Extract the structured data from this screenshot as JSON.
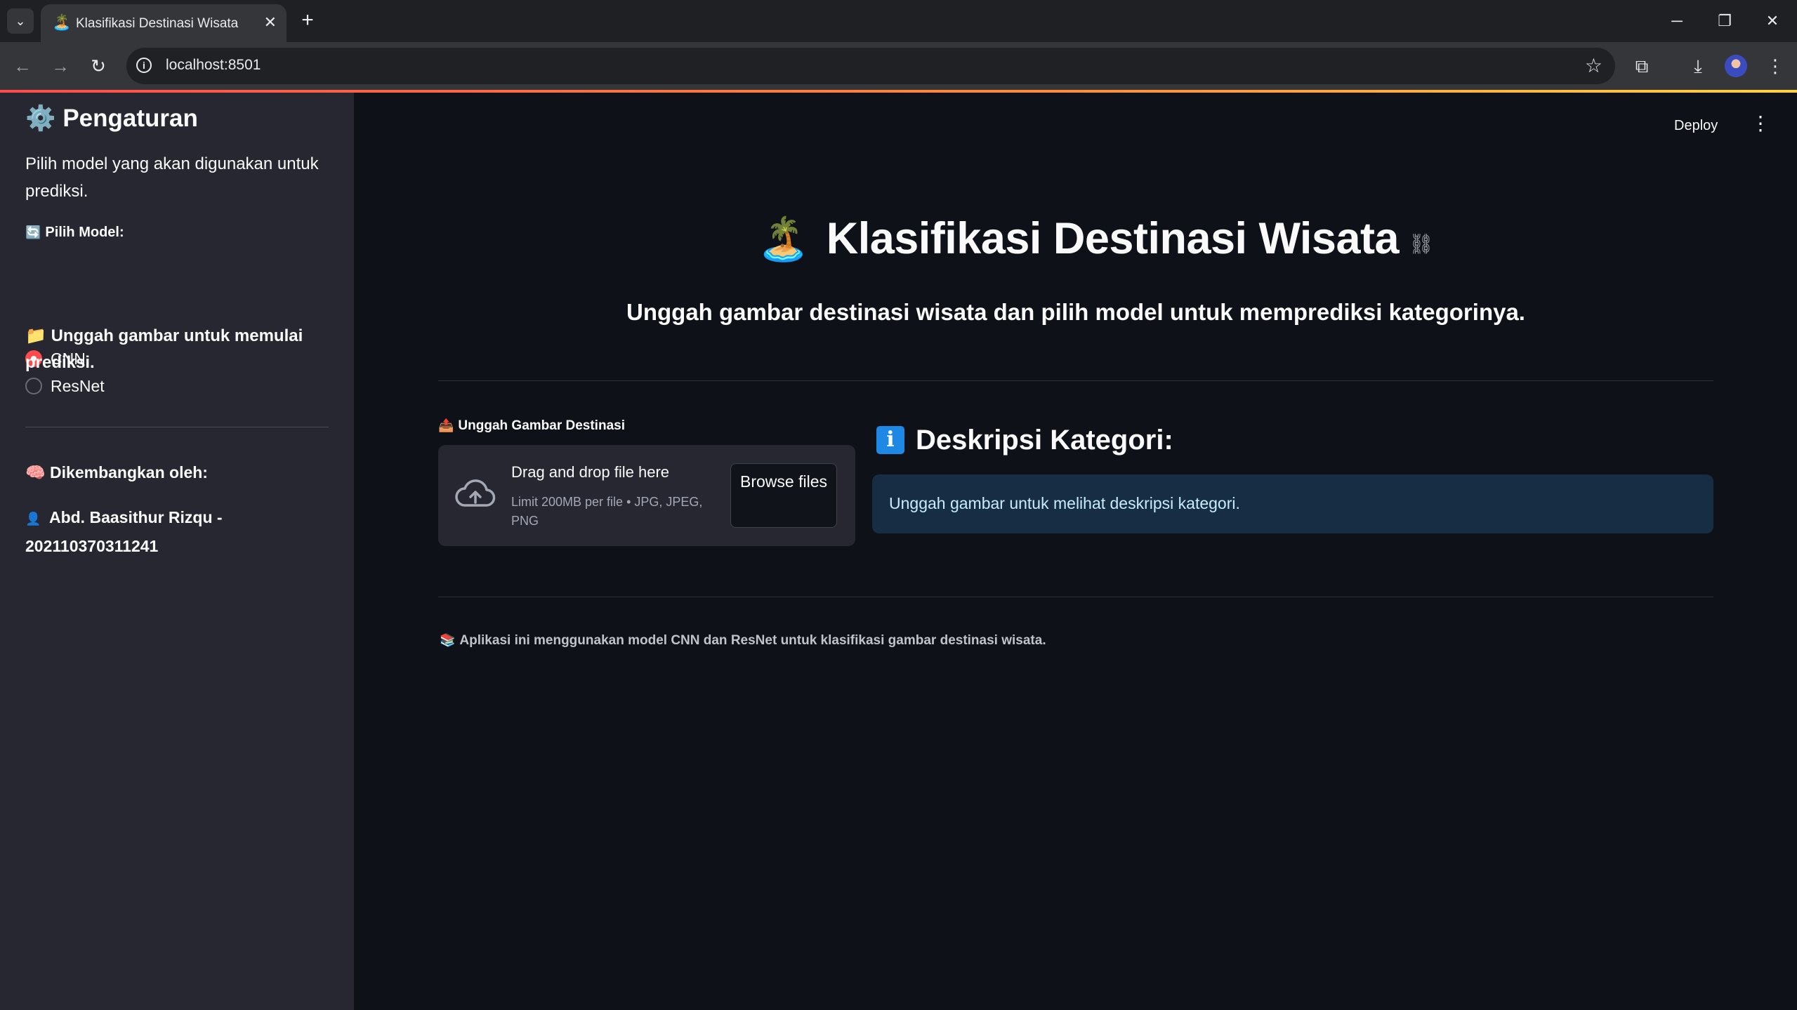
{
  "browser": {
    "tab_title": "Klasifikasi Destinasi Wisata",
    "tab_favicon": "🏝️",
    "url": "localhost:8501"
  },
  "sidebar": {
    "title_icon": "⚙️",
    "title": "Pengaturan",
    "description": "Pilih model yang akan digunakan untuk prediksi.",
    "model_label_icon": "🔄",
    "model_label": "Pilih Model:",
    "options": [
      {
        "label": "CNN",
        "selected": true
      },
      {
        "label": "ResNet",
        "selected": false
      }
    ],
    "hint_icon": "📁",
    "hint": "Unggah gambar untuk memulai prediksi.",
    "developed_icon": "🧠",
    "developed_by": "Dikembangkan oleh:",
    "author_icon": "👤",
    "author": "Abd. Baasithur Rizqu - 202110370311241"
  },
  "header": {
    "deploy_label": "Deploy"
  },
  "main": {
    "title_icon": "🏝️",
    "title": "Klasifikasi Destinasi Wisata",
    "subtitle": "Unggah gambar destinasi wisata dan pilih model untuk memprediksi kategorinya.",
    "upload": {
      "label_icon": "📤",
      "label": "Unggah Gambar Destinasi",
      "drag_text": "Drag and drop file here",
      "limit_text": "Limit 200MB per file • JPG, JPEG, PNG",
      "browse_label": "Browse files"
    },
    "description": {
      "icon": "i",
      "heading": "Deskripsi Kategori:",
      "info_text": "Unggah gambar untuk melihat deskripsi kategori."
    },
    "footer_icon": "📚",
    "footer": "Aplikasi ini menggunakan model CNN dan ResNet untuk klasifikasi gambar destinasi wisata."
  },
  "colors": {
    "background": "#0e1117",
    "sidebar": "#262730",
    "accent": "#ff4b4b",
    "info_bg": "#172d43",
    "info_text": "#c7ebff"
  }
}
